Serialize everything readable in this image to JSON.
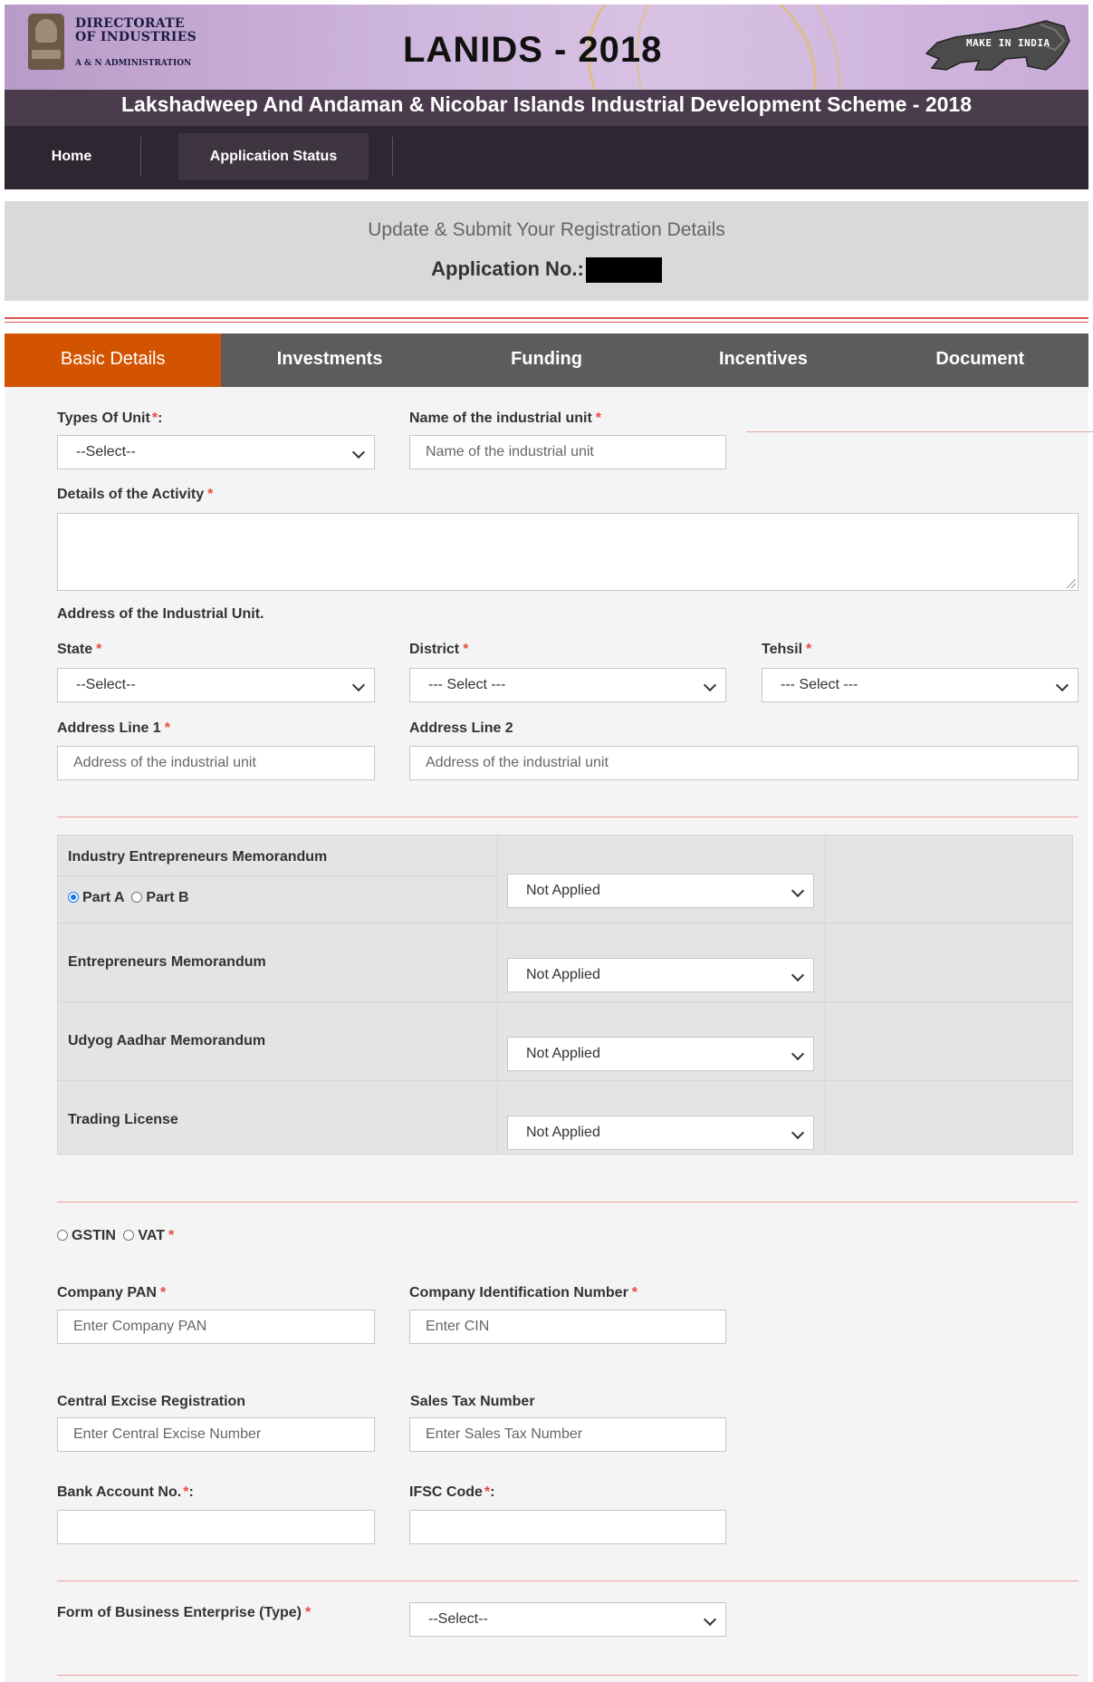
{
  "header": {
    "directorate_line1": "DIRECTORATE",
    "directorate_line2": "OF INDUSTRIES",
    "directorate_sub": "A & N ADMINISTRATION",
    "title": "LANIDS - 2018",
    "make_in_india": "MAKE IN INDIA",
    "subtitle": "Lakshadweep And Andaman & Nicobar Islands Industrial Development Scheme - 2018"
  },
  "nav": {
    "home": "Home",
    "application_status": "Application Status"
  },
  "application": {
    "heading": "Update & Submit Your Registration Details",
    "number_label": "Application No.:"
  },
  "tabs": [
    "Basic Details",
    "Investments",
    "Funding",
    "Incentives",
    "Document"
  ],
  "active_tab": "Basic Details",
  "form": {
    "types_of_unit": {
      "label": "Types Of Unit",
      "suffix": ":",
      "value": "--Select--"
    },
    "unit_name": {
      "label": "Name of the industrial unit",
      "placeholder": "Name of the industrial unit"
    },
    "activity_details": {
      "label": "Details of the Activity"
    },
    "address_heading": "Address of the Industrial Unit.",
    "state": {
      "label": "State",
      "value": "--Select--"
    },
    "district": {
      "label": "District",
      "value": "--- Select ---"
    },
    "tehsil": {
      "label": "Tehsil",
      "value": "--- Select ---"
    },
    "address_line1": {
      "label": "Address Line 1",
      "placeholder": "Address of the industrial unit"
    },
    "address_line2": {
      "label": "Address Line 2",
      "placeholder": "Address of the industrial unit"
    },
    "memorandums": [
      {
        "label": "Industry Entrepreneurs Memorandum",
        "value": "Not Applied",
        "options": [
          "Part A",
          "Part B"
        ],
        "selected": "Part A"
      },
      {
        "label": "Entrepreneurs Memorandum",
        "value": "Not Applied"
      },
      {
        "label": "Udyog Aadhar Memorandum",
        "value": "Not Applied"
      },
      {
        "label": "Trading License",
        "value": "Not Applied"
      }
    ],
    "tax_type": {
      "options": [
        "GSTIN",
        "VAT"
      ]
    },
    "company_pan": {
      "label": "Company PAN",
      "placeholder": "Enter Company PAN"
    },
    "cin": {
      "label": "Company Identification Number",
      "placeholder": "Enter CIN"
    },
    "central_excise": {
      "label": "Central Excise Registration",
      "placeholder": "Enter Central Excise Number"
    },
    "sales_tax": {
      "label": "Sales Tax Number",
      "placeholder": "Enter Sales Tax Number"
    },
    "bank_account": {
      "label": "Bank Account No.",
      "suffix": ":"
    },
    "ifsc": {
      "label": "IFSC Code",
      "suffix": ":"
    },
    "business_form": {
      "label": "Form of Business Enterprise (Type)",
      "value": "--Select--"
    }
  },
  "required_mark": "*"
}
